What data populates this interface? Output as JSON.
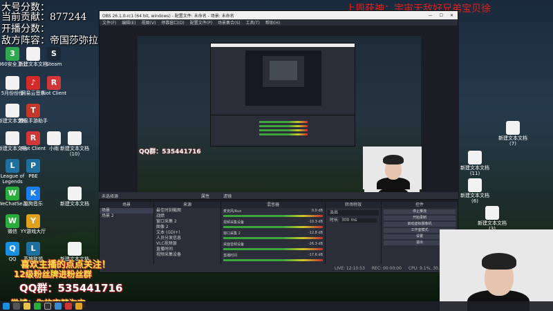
{
  "overlay": {
    "line1": "大号分数：",
    "line2": "当前贡献：877244",
    "line3": "开播分数：",
    "line4": "敌方阵容：帝国莎弥拉(无尽轻舞分袋) 二狙 斗枪",
    "red_slogan": "上周获神：宇宙无敌好兄弟宝贝徐",
    "follow": "喜欢主播的点点关注！",
    "group_join": "12级粉丝牌进粉丝群",
    "qq_group": "QQ群：535441716",
    "weibo": "微博：你的宋梦淘宝"
  },
  "desktop_icons": [
    {
      "label": "360安全卫士",
      "color": "#2fa84f",
      "glyph": "3"
    },
    {
      "label": "新建文本文档",
      "color": "doc",
      "glyph": ""
    },
    {
      "label": "Steam",
      "color": "#1b2838",
      "glyph": "S"
    },
    {
      "label": "5月份份份",
      "color": "doc",
      "glyph": ""
    },
    {
      "label": "网易云音乐",
      "color": "#d42a2a",
      "glyph": "♪"
    },
    {
      "label": "Riot Client",
      "color": "#d13639",
      "glyph": "R"
    },
    {
      "label": "新建文本文档",
      "color": "doc",
      "glyph": ""
    },
    {
      "label": "腾讯手游助手",
      "color": "#c0392b",
      "glyph": "T"
    },
    {
      "label": "新建文本文档",
      "color": "doc",
      "glyph": ""
    },
    {
      "label": "Riot Client",
      "color": "#d13639",
      "glyph": "R"
    },
    {
      "label": "小雨",
      "color": "doc",
      "glyph": ""
    },
    {
      "label": "新建文本文档 (10)",
      "color": "doc",
      "glyph": ""
    },
    {
      "label": "League of Legends",
      "color": "#1f6f9f",
      "glyph": "L"
    },
    {
      "label": "PBE",
      "color": "#1f6f9f",
      "glyph": "P"
    },
    {
      "label": "WeChatSe...",
      "color": "#2aae3b",
      "glyph": "W"
    },
    {
      "label": "酷狗音乐",
      "color": "#1a7ef0",
      "glyph": "K"
    },
    {
      "label": "新建文本文档",
      "color": "doc",
      "glyph": ""
    },
    {
      "label": "微信",
      "color": "#2aae3b",
      "glyph": "W"
    },
    {
      "label": "YY游戏大厅",
      "color": "#e0a020",
      "glyph": "Y"
    },
    {
      "label": "QQ",
      "color": "#1a8fe0",
      "glyph": "Q"
    },
    {
      "label": "英雄联盟",
      "color": "#1f6f9f",
      "glyph": "L"
    },
    {
      "label": "新建文本文档",
      "color": "doc",
      "glyph": ""
    }
  ],
  "right_icons": [
    {
      "label": "新建文本文档 (7)"
    },
    {
      "label": "新建文本文档 (11)"
    },
    {
      "label": "新建文本文档 (6)"
    },
    {
      "label": "新建文本文档 (3)"
    }
  ],
  "obs": {
    "title": "OBS 26.1.0-rc1 (64 bit, windows) - 配置文件: 未命名 - 场景: 未命名",
    "menu": [
      "文件(F)",
      "编辑(E)",
      "视图(V)",
      "停靠窗口(D)",
      "配置文件(P)",
      "场景集合(S)",
      "工具(T)",
      "帮助(H)"
    ],
    "no_source": "未选择源",
    "props_btn": "属性",
    "filters_btn": "滤镜",
    "scenes_title": "场景",
    "scenes": [
      "场景",
      "场景 2"
    ],
    "sources_title": "来源",
    "sources": [
      "最佳时刻截图",
      "战绩",
      "窗口采集 2",
      "图像 2",
      "文本 (GDI+)",
      "人员分发信息",
      "VLC视频源",
      "直播时间",
      "视频采集设备"
    ],
    "mixer_title": "混音器",
    "mixer": [
      {
        "name": "麦克风/Aux",
        "db": "0.0 dB"
      },
      {
        "name": "视频采集设备",
        "db": "-10.3 dB"
      },
      {
        "name": "窗口采集 2",
        "db": "-12.8 dB"
      },
      {
        "name": "桌面音频设备",
        "db": "-26.3 dB"
      },
      {
        "name": "直播时间",
        "db": "-17.6 dB"
      }
    ],
    "transition_title": "转场特效",
    "transition_value": "淡出",
    "duration_label": "时长",
    "duration_value": "300 ms",
    "controls_title": "控件",
    "controls": [
      "停止推流",
      "开始录制",
      "启动虚拟摄像机",
      "工作室模式",
      "设置",
      "退出"
    ],
    "status": [
      "LIVE: 12:10:53",
      "REC: 00:00:00",
      "CPU: 9.1%, 30.00 fps"
    ]
  }
}
